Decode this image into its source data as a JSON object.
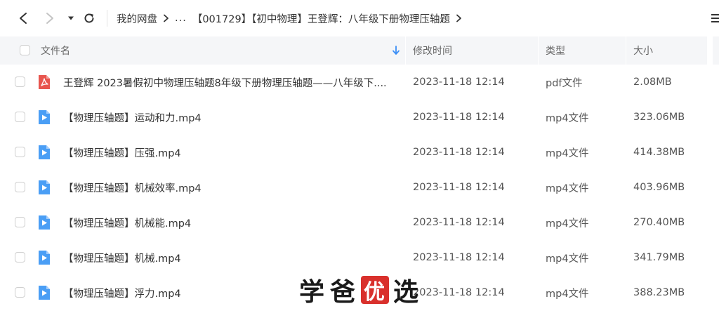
{
  "nav": {
    "breadcrumb_root": "我的网盘",
    "breadcrumb_ellipsis": "...",
    "breadcrumb_current": "【001729】【初中物理】王登辉：八年级下册物理压轴题"
  },
  "table": {
    "headers": {
      "name": "文件名",
      "time": "修改时间",
      "type": "类型",
      "size": "大小"
    },
    "rows": [
      {
        "icon": "pdf-icon",
        "name": "王登辉 2023暑假初中物理压轴题8年级下册物理压轴题——八年级下....",
        "time": "2023-11-18 12:14",
        "type": "pdf文件",
        "size": "2.08MB"
      },
      {
        "icon": "video-icon",
        "name": "【物理压轴题】运动和力.mp4",
        "time": "2023-11-18 12:14",
        "type": "mp4文件",
        "size": "323.06MB"
      },
      {
        "icon": "video-icon",
        "name": "【物理压轴题】压强.mp4",
        "time": "2023-11-18 12:14",
        "type": "mp4文件",
        "size": "414.38MB"
      },
      {
        "icon": "video-icon",
        "name": "【物理压轴题】机械效率.mp4",
        "time": "2023-11-18 12:14",
        "type": "mp4文件",
        "size": "403.96MB"
      },
      {
        "icon": "video-icon",
        "name": "【物理压轴题】机械能.mp4",
        "time": "2023-11-18 12:14",
        "type": "mp4文件",
        "size": "270.40MB"
      },
      {
        "icon": "video-icon",
        "name": "【物理压轴题】机械.mp4",
        "time": "2023-11-18 12:14",
        "type": "mp4文件",
        "size": "341.79MB"
      },
      {
        "icon": "video-icon",
        "name": "【物理压轴题】浮力.mp4",
        "time": "2023-11-18 12:14",
        "type": "mp4文件",
        "size": "388.23MB"
      }
    ]
  },
  "watermark": {
    "chars": [
      "学",
      "爸",
      "优",
      "选"
    ]
  },
  "colors": {
    "accent": "#3a8ef6",
    "pdf_red": "#e8554e",
    "video_blue": "#4a9ef5",
    "header_bg": "#f5f6f8",
    "seal_red": "#d9302c"
  }
}
